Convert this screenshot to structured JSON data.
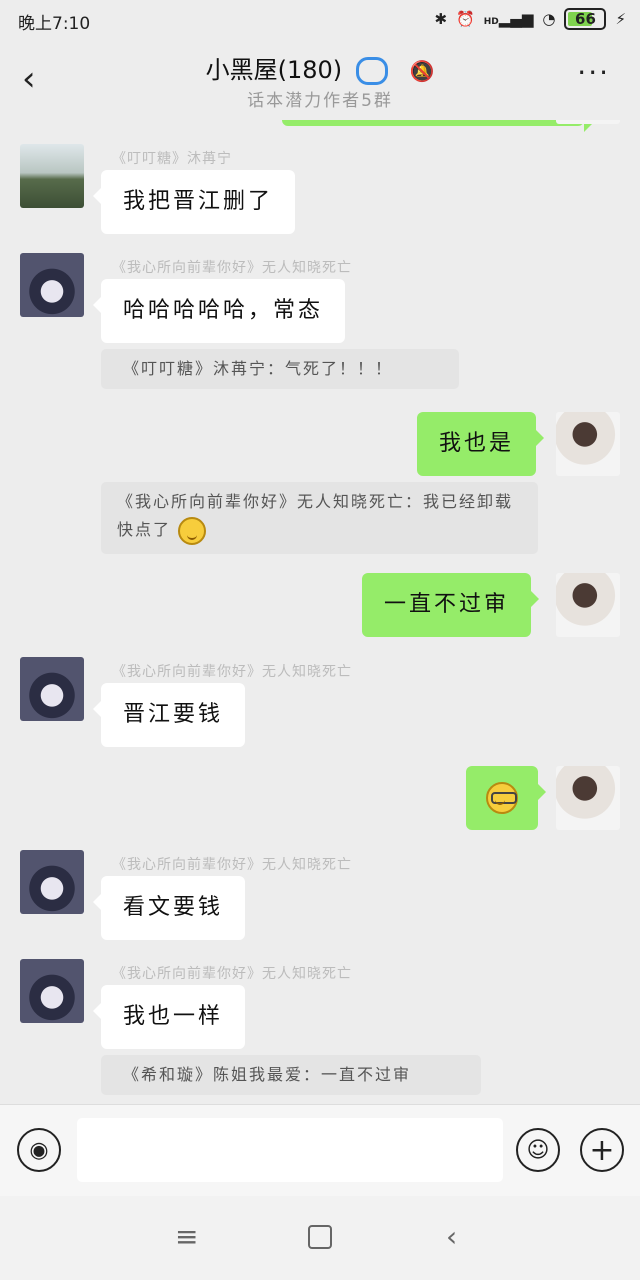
{
  "status": {
    "time": "晚上7:10",
    "battery": "66",
    "net": "HD"
  },
  "header": {
    "back": "‹",
    "title": "小黑屋(180)",
    "subtitle": "话本潜力作者5群",
    "more": "···"
  },
  "messages": {
    "m1": {
      "sender": "《叮叮糖》沐苒宁",
      "text": "我把晋江删了"
    },
    "m2": {
      "sender": "《我心所向前辈你好》无人知晓死亡",
      "text": "哈哈哈哈哈，常态",
      "quote": "《叮叮糖》沐苒宁：气死了！！！"
    },
    "m3": {
      "text": "我也是",
      "quote": "《我心所向前辈你好》无人知晓死亡：我已经卸载快点了"
    },
    "m4": {
      "text": "一直不过审"
    },
    "m5": {
      "sender": "《我心所向前辈你好》无人知晓死亡",
      "text": "晋江要钱"
    },
    "m6": {
      "emoji": "nerd-face"
    },
    "m7": {
      "sender": "《我心所向前辈你好》无人知晓死亡",
      "text": "看文要钱"
    },
    "m8": {
      "sender": "《我心所向前辈你好》无人知晓死亡",
      "text": "我也一样",
      "quote": "《希和璇》陈姐我最爱：一直不过审"
    }
  },
  "input": {
    "placeholder": ""
  },
  "colors": {
    "outgoing_bubble": "#95ec69",
    "incoming_bubble": "#ffffff",
    "background": "#ededed"
  }
}
